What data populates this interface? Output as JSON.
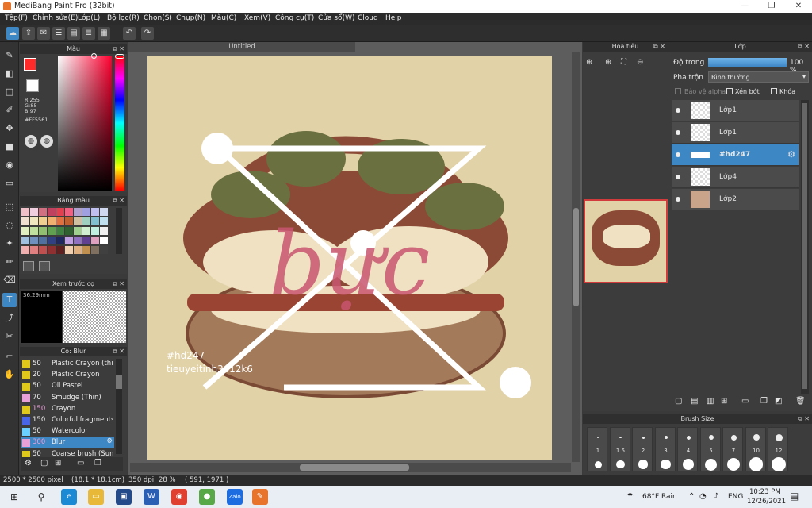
{
  "window": {
    "title": "MediBang Paint Pro (32bit)",
    "minimize": "—",
    "maximize": "❐",
    "close": "✕"
  },
  "menu": [
    "Tệp(F)",
    "Chỉnh sửa(E)",
    "Lớp(L)",
    "Bộ lọc(R)",
    "Chọn(S)",
    "Chụp(N)",
    "Màu(C)",
    "Xem(V)",
    "Công cụ(T)",
    "Cửa sổ(W)",
    "Cloud",
    "Help"
  ],
  "color_panel": {
    "title": "Màu",
    "r": "R:255",
    "g": "G:85",
    "b": "B:97",
    "hex": "#FF5561",
    "primary_color": "#ff2a2a"
  },
  "swatch_panel": {
    "title": "Bảng màu"
  },
  "preview_panel": {
    "title": "Xem trước cọ",
    "size": "36.29mm"
  },
  "brush_panel": {
    "title": "Cọ: Blur",
    "items": [
      {
        "size": "50",
        "name": "Plastic Crayon (thick)",
        "color": "#e0c81a"
      },
      {
        "size": "20",
        "name": "Plastic Crayon",
        "color": "#e0c81a"
      },
      {
        "size": "50",
        "name": "Oil Pastel",
        "color": "#e0c81a"
      },
      {
        "size": "70",
        "name": "Smudge (Thin)",
        "color": "#e8a0d8"
      },
      {
        "size": "150",
        "name": "Crayon",
        "color": "#e0c81a"
      },
      {
        "size": "150",
        "name": "Colorful fragments",
        "color": "#4a66e8"
      },
      {
        "size": "50",
        "name": "Watercolor",
        "color": "#6ad0ff"
      },
      {
        "size": "300",
        "name": "Blur",
        "color": "#e8a0d8"
      },
      {
        "size": "50",
        "name": "Coarse brush (Sumi)",
        "color": "#e0c81a"
      }
    ]
  },
  "document": {
    "tab": "Untitled"
  },
  "artwork": {
    "title_text": "bực",
    "watermark_line1": "#hd247",
    "watermark_line2": "tieuyeitinh3o12k6"
  },
  "navigator": {
    "title": "Hoa tiêu"
  },
  "layer_panel": {
    "title": "Lớp",
    "opacity_label": "Độ trong",
    "opacity_value": "100 %",
    "blend_label": "Pha trộn",
    "blend_value": "Bình thường",
    "protect_alpha": "Bảo vệ alpha",
    "clip": "Xén bớt",
    "lock": "Khóa",
    "layers": [
      {
        "name": "Lớp1",
        "selected": false
      },
      {
        "name": "Lớp1",
        "selected": false
      },
      {
        "name": "#hd247",
        "selected": true
      },
      {
        "name": "Lớp4",
        "selected": false
      },
      {
        "name": "Lớp2",
        "selected": false
      }
    ]
  },
  "brush_size_panel": {
    "title": "Brush Size",
    "labels": [
      "1",
      "1.5",
      "2",
      "3",
      "4",
      "5",
      "7",
      "10",
      "12"
    ]
  },
  "status": {
    "dimensions": "2500 * 2500 pixel",
    "physical": "(18.1 * 18.1cm)",
    "dpi": "350 dpi",
    "zoom": "28 %",
    "cursor": "( 591, 1971 )"
  },
  "taskbar": {
    "weather": "68°F  Rain",
    "lang": "ENG",
    "time": "10:23 PM",
    "date": "12/26/2021"
  }
}
